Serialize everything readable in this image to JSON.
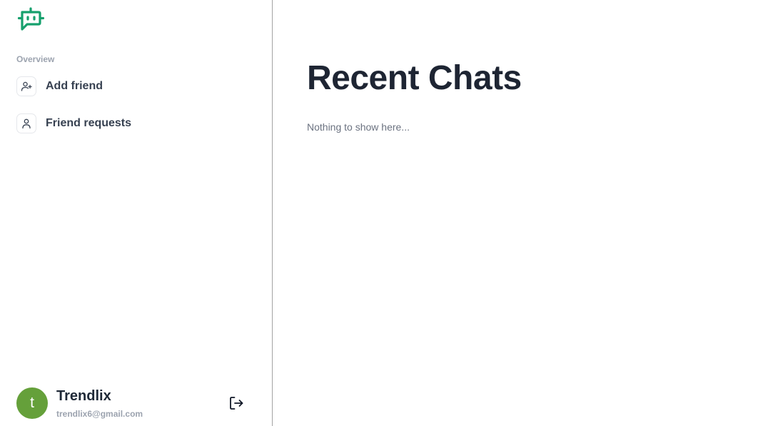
{
  "sidebar": {
    "logo_icon": "chat-bot-logo-icon",
    "logo_color": "#16a06d",
    "section_label": "Overview",
    "items": [
      {
        "label": "Add friend",
        "icon": "user-plus-icon"
      },
      {
        "label": "Friend requests",
        "icon": "user-icon"
      }
    ]
  },
  "profile": {
    "avatar_initial": "t",
    "avatar_color": "#65a03a",
    "name": "Trendlix",
    "email": "trendlix6@gmail.com",
    "signout_icon": "sign-out-icon"
  },
  "main": {
    "title": "Recent Chats",
    "empty_message": "Nothing to show here..."
  }
}
